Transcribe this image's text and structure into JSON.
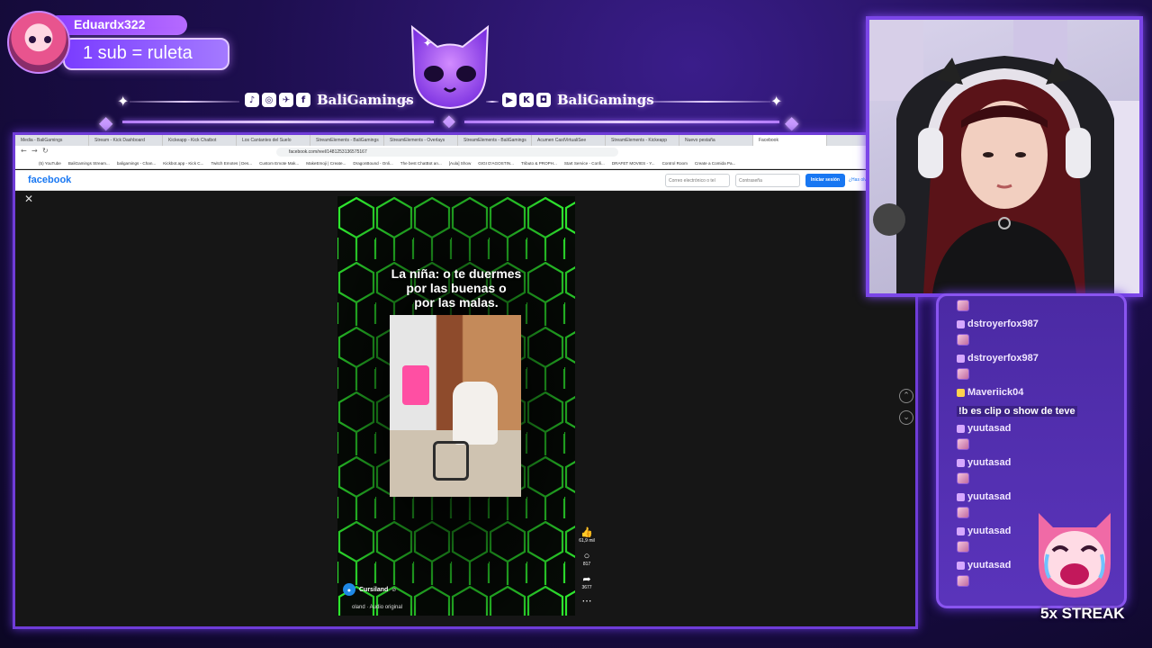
{
  "sub_alert": {
    "username": "Eduardx322",
    "goal_text": "1 sub = ruleta"
  },
  "socials": {
    "left_icons": [
      "tiktok-icon",
      "instagram-icon",
      "twitter-icon",
      "facebook-icon"
    ],
    "left_handle": "BaliGamings",
    "right_icons": [
      "youtube-icon",
      "kick-icon",
      "twitch-icon"
    ],
    "right_handle": "BaliGamings"
  },
  "browser": {
    "tabs": [
      "Media - BaliGamings",
      "Stream - Kick Dashboard",
      "Kickeapp - Kick Chatbot",
      "Los Cantantes del Suelo",
      "StreamElements - BaliGamings",
      "StreamElements - Overlays",
      "StreamElements - BaliGamings",
      "Acumen CastVirtualiSee",
      "StreamElements - Kickeapp",
      "Nuevo pestaña",
      "Facebook"
    ],
    "address": "facebook.com/reel/1481253136575167",
    "bookmarks": [
      "(5) YouTube",
      "BaliGamings Stream...",
      "baligamings - Chan...",
      "Kickbot.app - Kick C...",
      "Twitch Emotes | Des...",
      "Custom Emote Mak...",
      "MakeEmoji | Create...",
      "DragonBound - Onli...",
      "The best ChatBot an...",
      "[Aula] Show",
      "GIGI D'AGOSTIN...",
      "Tributo & PROPH...",
      "Start Service - Confi...",
      "DRAFET MOVIES - Y...",
      "Control Room",
      "Create a Comida Pa..."
    ]
  },
  "facebook": {
    "logo": "facebook",
    "email_placeholder": "Correo electrónico o tel",
    "password_placeholder": "Contraseña",
    "login_label": "Iniciar sesión",
    "forgot_label": "¿Has olv"
  },
  "reel": {
    "caption": "La niña: o te duermes\npor las buenas o\npor las malas.",
    "likes": "61,9 mil",
    "comments": "817",
    "shares": "3677",
    "author": "Cursiland",
    "audio": "oland · Audio original",
    "colors": {
      "hex_glow": "#2eff2e",
      "hex_dark": "#050805"
    }
  },
  "chat": {
    "messages": [
      {
        "type": "emote"
      },
      {
        "type": "user",
        "user": "dstroyerfox987"
      },
      {
        "type": "emote"
      },
      {
        "type": "user",
        "user": "dstroyerfox987"
      },
      {
        "type": "emote"
      },
      {
        "type": "user",
        "user": "Maveriick04"
      },
      {
        "type": "text",
        "text": "!b es clip o show de teve"
      },
      {
        "type": "user",
        "user": "yuutasad"
      },
      {
        "type": "emote"
      },
      {
        "type": "user",
        "user": "yuutasad"
      },
      {
        "type": "emote"
      },
      {
        "type": "user",
        "user": "yuutasad"
      },
      {
        "type": "emote"
      },
      {
        "type": "user",
        "user": "yuutasad"
      },
      {
        "type": "emote"
      },
      {
        "type": "user",
        "user": "yuutasad"
      },
      {
        "type": "emote"
      }
    ]
  },
  "streak": "5x STREAK",
  "colors": {
    "accent": "#7b46e8",
    "background": "#1d0e4e",
    "facebook_blue": "#1877f2"
  }
}
